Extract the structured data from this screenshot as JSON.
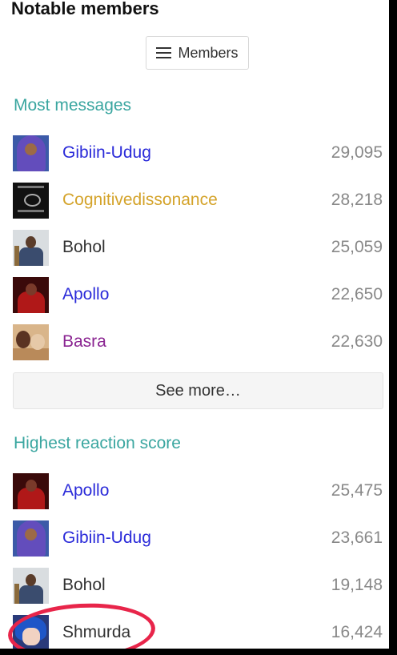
{
  "page_title": "Notable members",
  "members_button": {
    "label": "Members",
    "icon": "hamburger-icon"
  },
  "most_messages": {
    "title": "Most messages",
    "rows": [
      {
        "name": "Gibiin-Udug",
        "count": "29,095",
        "color": "#2a2ad9"
      },
      {
        "name": "Cognitivedissonance",
        "count": "28,218",
        "color": "#d4a32a"
      },
      {
        "name": "Bohol",
        "count": "25,059",
        "color": "#333333"
      },
      {
        "name": "Apollo",
        "count": "22,650",
        "color": "#2a2ad9"
      },
      {
        "name": "Basra",
        "count": "22,630",
        "color": "#8a2491"
      }
    ],
    "see_more": "See more…"
  },
  "highest_reaction": {
    "title": "Highest reaction score",
    "rows": [
      {
        "name": "Apollo",
        "count": "25,475",
        "color": "#2a2ad9"
      },
      {
        "name": "Gibiin-Udug",
        "count": "23,661",
        "color": "#2a2ad9"
      },
      {
        "name": "Bohol",
        "count": "19,148",
        "color": "#333333"
      },
      {
        "name": "Shmurda",
        "count": "16,424",
        "color": "#333333"
      }
    ]
  },
  "accent_color": "#3aa6a0",
  "annotation_color": "#e8254a"
}
